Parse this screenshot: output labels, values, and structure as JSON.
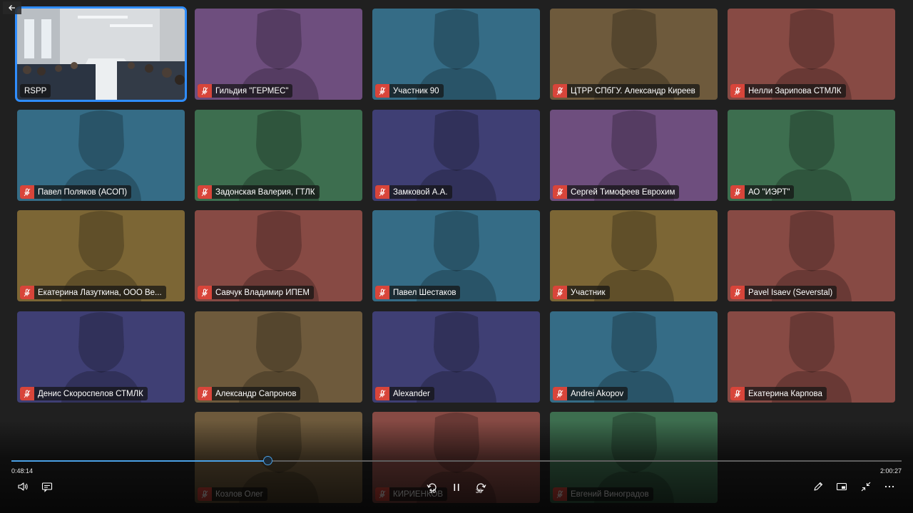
{
  "player": {
    "elapsed": "0:48:14",
    "duration": "2:00:27",
    "progress_fraction": 0.2886,
    "skip_back_seconds": "10",
    "skip_forward_seconds": "30"
  },
  "colors": {
    "accent": "#4aa0e6",
    "active_border": "#2f8dff",
    "muted_mic": "#d8453a"
  },
  "tiles": [
    {
      "name": "RSPP",
      "color": "#cfd3d6",
      "video": true,
      "muted": false,
      "active": true
    },
    {
      "name": "Гильдия \"ГЕРМЕС\"",
      "color": "#6e4e7e",
      "muted": true
    },
    {
      "name": "Участник 90",
      "color": "#356c86",
      "muted": true
    },
    {
      "name": "ЦТРР СПбГУ. Александр Киреев",
      "color": "#6e5a3c",
      "muted": true
    },
    {
      "name": "Нелли Зарипова СТМЛК",
      "color": "#874a44",
      "muted": true
    },
    {
      "name": "Павел Поляков (АСОП)",
      "color": "#356c86",
      "muted": true
    },
    {
      "name": "Задонская Валерия, ГТЛК",
      "color": "#3d6e4f",
      "muted": true
    },
    {
      "name": "Замковой А.А.",
      "color": "#3f3f74",
      "muted": true
    },
    {
      "name": "Сергей Тимофеев Еврохим",
      "color": "#6e4e7e",
      "muted": true
    },
    {
      "name": "АО \"ИЭРТ\"",
      "color": "#3d6e4f",
      "muted": true
    },
    {
      "name": "Екатерина Лазуткина, ООО Ве...",
      "color": "#7c6635",
      "muted": true
    },
    {
      "name": "Савчук Владимир ИПЕМ",
      "color": "#874a44",
      "muted": true
    },
    {
      "name": "Павел Шестаков",
      "color": "#356c86",
      "muted": true
    },
    {
      "name": "Участник",
      "color": "#7c6635",
      "muted": true
    },
    {
      "name": "Pavel Isaev (Severstal)",
      "color": "#874a44",
      "muted": true
    },
    {
      "name": "Денис Скороспелов СТМЛК",
      "color": "#3f3f74",
      "muted": true
    },
    {
      "name": "Александр Сапронов",
      "color": "#6e5a3c",
      "muted": true
    },
    {
      "name": "Alexander",
      "color": "#3f3f74",
      "muted": true
    },
    {
      "name": "Andrei Akopov",
      "color": "#356c86",
      "muted": true
    },
    {
      "name": "Екатерина Карпова",
      "color": "#874a44",
      "muted": true
    },
    {
      "name": "Козлов Олег",
      "color": "#6e5a3c",
      "muted": true
    },
    {
      "name": "КИРИЕНКОВ",
      "color": "#874a44",
      "muted": true
    },
    {
      "name": "Евгений Виноградов",
      "color": "#3d6e4f",
      "muted": true
    }
  ],
  "icons": {
    "back": "arrow-left-icon",
    "volume": "speaker-icon",
    "captions": "captions-icon",
    "rewind": "rewind-10-icon",
    "pause": "pause-icon",
    "forward": "forward-30-icon",
    "edit": "pencil-icon",
    "miniplayer": "miniplayer-icon",
    "exit_fullscreen": "collapse-icon",
    "more": "more-icon"
  }
}
